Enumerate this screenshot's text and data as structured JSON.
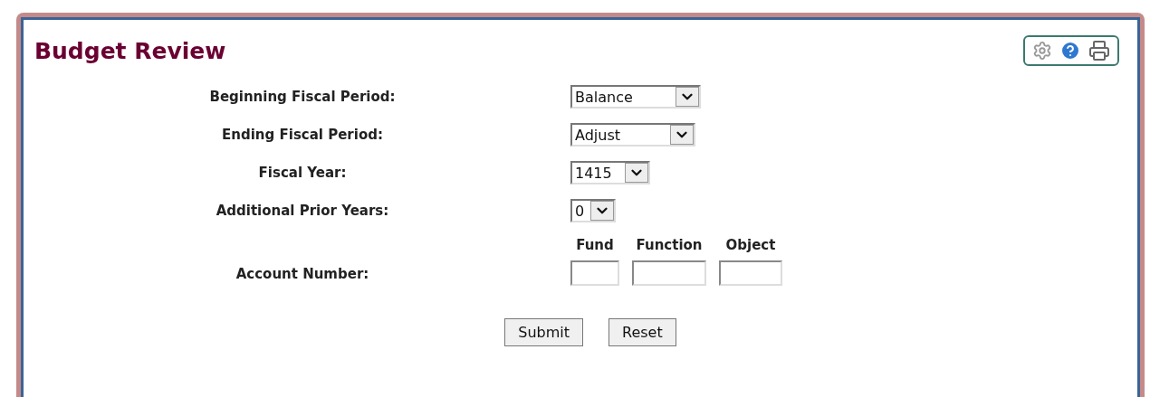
{
  "title": "Budget Review",
  "fields": [
    {
      "kind": "select",
      "label": "Beginning Fiscal Period:",
      "value": "Balance"
    },
    {
      "kind": "select",
      "label": "Ending Fiscal Period:",
      "value": "Adjust"
    },
    {
      "kind": "select",
      "label": "Fiscal Year:",
      "value": "1415"
    },
    {
      "kind": "select",
      "label": "Additional Prior Years:",
      "value": "0"
    }
  ],
  "account": {
    "label": "Account Number:",
    "parts": [
      {
        "heading": "Fund"
      },
      {
        "heading": "Function"
      },
      {
        "heading": "Object"
      }
    ]
  },
  "buttons": [
    "Submit",
    "Reset"
  ]
}
